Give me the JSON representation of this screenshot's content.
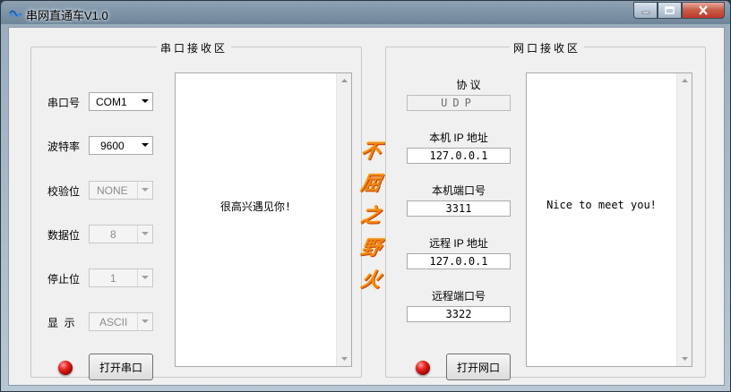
{
  "window": {
    "title": "串网直通车V1.0",
    "controls": {
      "minimize": "minimize-icon",
      "maximize": "maximize-icon",
      "close": "close-icon"
    }
  },
  "serial": {
    "group_title": "串口接收区",
    "port_label": "串口号",
    "port_value": "COM1",
    "baud_label": "波特率",
    "baud_value": "9600",
    "parity_label": "校验位",
    "parity_value": "NONE",
    "databits_label": "数据位",
    "databits_value": "8",
    "stopbits_label": "停止位",
    "stopbits_value": "1",
    "display_label": "显  示",
    "display_value": "ASCII",
    "open_button": "打开串口",
    "received_text": "很高兴遇见你!",
    "led_color": "#e8231f"
  },
  "network": {
    "group_title": "网口接收区",
    "protocol_label": "协 议",
    "protocol_value": "UDP",
    "local_ip_label": "本机 IP 地址",
    "local_ip_value": "127.0.0.1",
    "local_port_label": "本机端口号",
    "local_port_value": "3311",
    "remote_ip_label": "远程 IP 地址",
    "remote_ip_value": "127.0.0.1",
    "remote_port_label": "远程端口号",
    "remote_port_value": "3322",
    "open_button": "打开网口",
    "received_text": "Nice to meet you!",
    "led_color": "#e8231f"
  },
  "slogan": [
    "不",
    "屈",
    "之",
    "野",
    "火"
  ],
  "colors": {
    "slogan": "#f08a12",
    "client_bg": "#f0f0f0"
  }
}
